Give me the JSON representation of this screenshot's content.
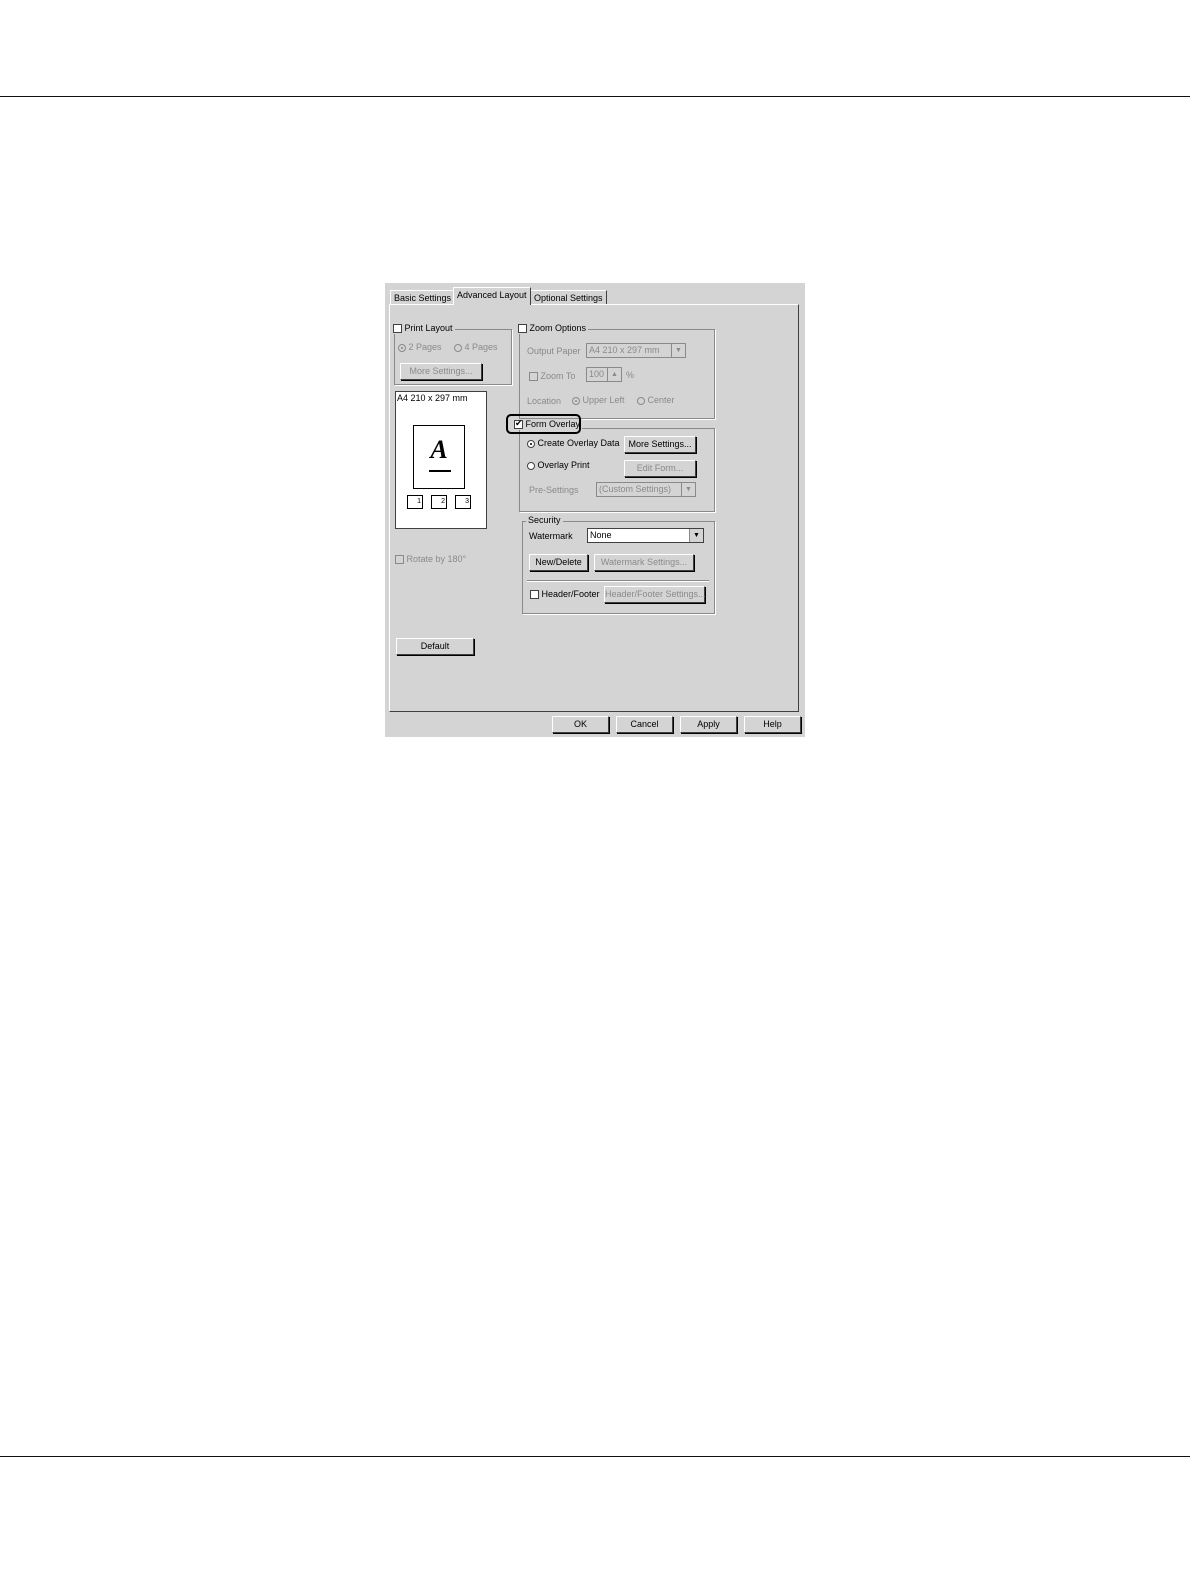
{
  "tabs": {
    "basic": "Basic Settings",
    "advanced": "Advanced Layout",
    "optional": "Optional Settings"
  },
  "print_layout": {
    "label": "Print Layout",
    "checked": false,
    "option_2pages": "2 Pages",
    "option_4pages": "4 Pages",
    "more_settings": "More Settings..."
  },
  "preview": {
    "paper_label": "A4 210 x 297 mm",
    "sample_letter": "A",
    "icon_numbers": [
      "1",
      "2",
      "3"
    ]
  },
  "rotate": {
    "label": "Rotate by 180°"
  },
  "default_button": "Default",
  "zoom_options": {
    "label": "Zoom Options",
    "checked": false,
    "output_paper_label": "Output Paper",
    "output_paper_value": "A4 210 x 297 mm",
    "zoom_to_label": "Zoom To",
    "zoom_to_value": "100",
    "zoom_unit": "%",
    "location_label": "Location",
    "location_upper_left": "Upper Left",
    "location_center": "Center"
  },
  "form_overlay": {
    "label": "Form Overlay",
    "checked": true,
    "create_overlay_data": "Create Overlay Data",
    "overlay_print": "Overlay Print",
    "more_settings": "More Settings...",
    "edit_form": "Edit Form...",
    "pre_settings_label": "Pre-Settings",
    "pre_settings_value": "(Custom Settings)"
  },
  "security": {
    "label": "Security",
    "watermark_label": "Watermark",
    "watermark_value": "None",
    "new_delete": "New/Delete",
    "watermark_settings": "Watermark Settings...",
    "header_footer_label": "Header/Footer",
    "header_footer_settings": "Header/Footer Settings..."
  },
  "footer_buttons": {
    "ok": "OK",
    "cancel": "Cancel",
    "apply": "Apply",
    "help": "Help"
  }
}
